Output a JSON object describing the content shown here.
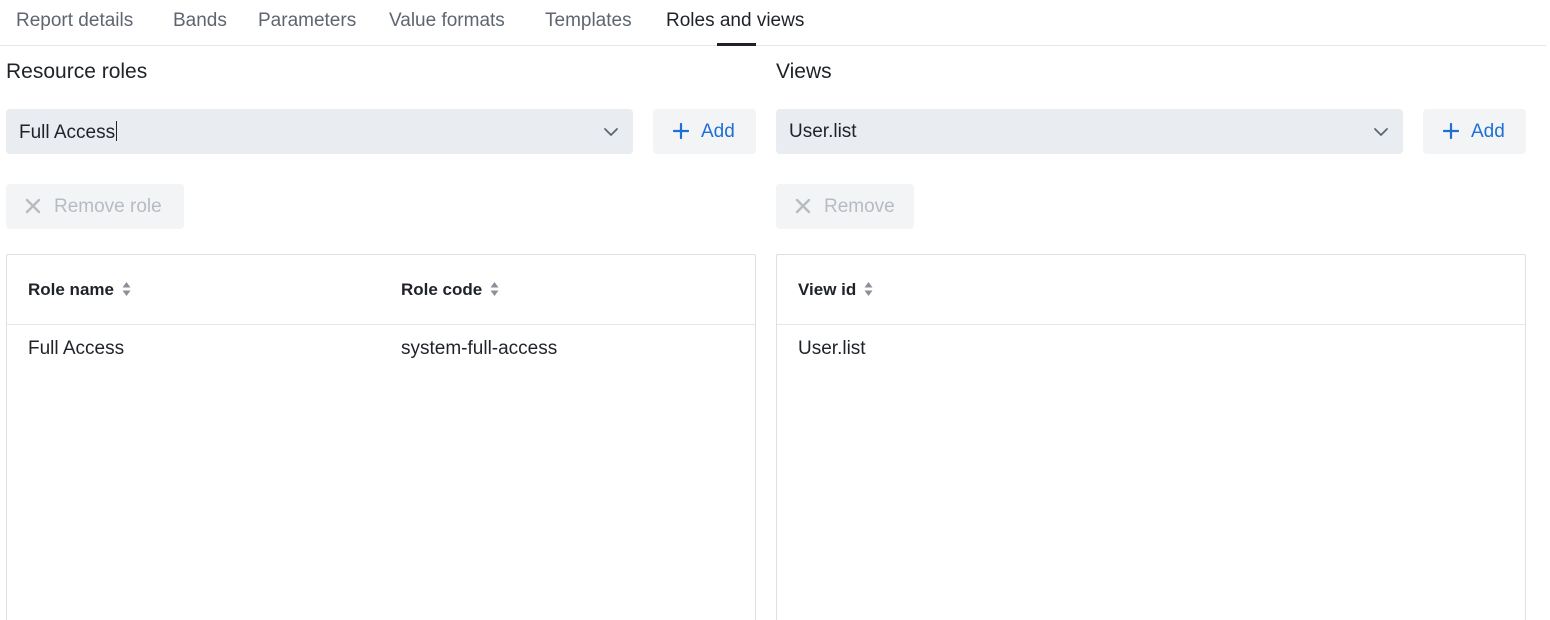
{
  "tabs": [
    {
      "label": "Report details",
      "active": false
    },
    {
      "label": "Bands",
      "active": false
    },
    {
      "label": "Parameters",
      "active": false
    },
    {
      "label": "Value formats",
      "active": false
    },
    {
      "label": "Templates",
      "active": false
    },
    {
      "label": "Roles and views",
      "active": true
    }
  ],
  "roles": {
    "title": "Resource roles",
    "select_value": "Full Access",
    "add_label": "Add",
    "remove_label": "Remove role",
    "columns": [
      "Role name",
      "Role code"
    ],
    "rows": [
      {
        "name": "Full Access",
        "code": "system-full-access"
      }
    ]
  },
  "views": {
    "title": "Views",
    "select_value": "User.list",
    "add_label": "Add",
    "remove_label": "Remove",
    "columns": [
      "View id"
    ],
    "rows": [
      {
        "id": "User.list"
      }
    ]
  },
  "colors": {
    "accent": "#1f6fd6",
    "disabled": "#b7bcc3",
    "select_bg": "#e9ecf0"
  },
  "icons": {
    "dropdown": "chevron-down-icon",
    "add": "plus-icon",
    "remove": "close-icon",
    "sort": "sort-icon"
  }
}
